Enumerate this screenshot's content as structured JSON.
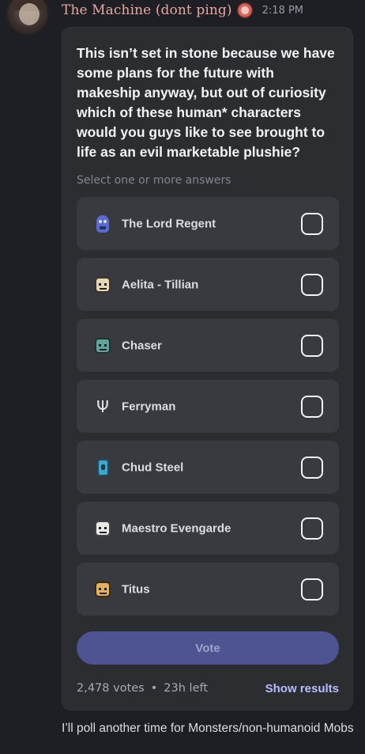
{
  "message": {
    "author": "The Machine (dont ping)",
    "timestamp": "2:18 PM"
  },
  "poll": {
    "question": "This isn’t set in stone because we have some plans for the future with makeship anyway, but out of curiosity which of these human* characters would you guys like to see brought to life as an evil marketable plushie?",
    "hint": "Select one or more answers",
    "answers": [
      {
        "label": "The Lord Regent",
        "icon": "blue-skull-icon"
      },
      {
        "label": "Aelita - Tillian",
        "icon": "pixel-face-icon"
      },
      {
        "label": "Chaser",
        "icon": "green-face-icon"
      },
      {
        "label": "Ferryman",
        "icon": "trident-icon"
      },
      {
        "label": "Chud Steel",
        "icon": "lantern-icon"
      },
      {
        "label": "Maestro Evengarde",
        "icon": "white-face-icon"
      },
      {
        "label": "Titus",
        "icon": "tan-face-icon"
      }
    ],
    "vote_label": "Vote",
    "votes": "2,478 votes",
    "separator": "•",
    "time_left": "23h left",
    "show_results": "Show results"
  },
  "followup_message": "I’ll poll another time for Monsters/non-humanoid Mobs",
  "colors": {
    "background": "#1e1f24",
    "card": "#2b2d31",
    "answer_bg": "#383a40",
    "username": "#e8a7a0",
    "vote_button": "#4e5491",
    "link": "#b6bcff"
  }
}
